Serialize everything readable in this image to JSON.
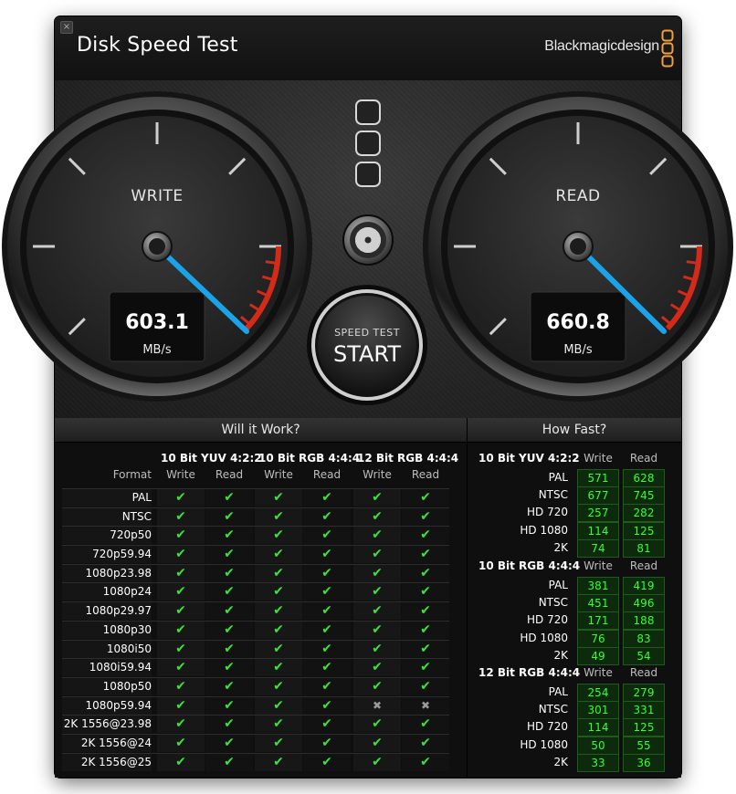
{
  "window": {
    "title": "Disk Speed Test",
    "brand": "Blackmagicdesign",
    "close_glyph": "×"
  },
  "gauges": {
    "write": {
      "label": "WRITE",
      "value": "603.1",
      "unit": "MB/s",
      "needle_fraction": 0.8
    },
    "read": {
      "label": "READ",
      "value": "660.8",
      "unit": "MB/s",
      "needle_fraction": 0.81
    }
  },
  "start_button": {
    "top_label": "SPEED TEST",
    "main_label": "START"
  },
  "colors": {
    "accent_blue": "#1aa3e8",
    "check_green": "#3ee03e",
    "speed_green": "#33ff33",
    "logo_orange": "#f0a040",
    "red_zone": "#d42a1a"
  },
  "will_it_work": {
    "title": "Will it Work?",
    "format_header": "Format",
    "groups": [
      "10 Bit YUV 4:2:2",
      "10 Bit RGB 4:4:4",
      "12 Bit RGB 4:4:4"
    ],
    "col_labels": [
      "Write",
      "Read"
    ],
    "check_glyph": "✔",
    "cross_glyph": "✖",
    "rows": [
      {
        "format": "PAL",
        "ok": [
          1,
          1,
          1,
          1,
          1,
          1
        ]
      },
      {
        "format": "NTSC",
        "ok": [
          1,
          1,
          1,
          1,
          1,
          1
        ]
      },
      {
        "format": "720p50",
        "ok": [
          1,
          1,
          1,
          1,
          1,
          1
        ]
      },
      {
        "format": "720p59.94",
        "ok": [
          1,
          1,
          1,
          1,
          1,
          1
        ]
      },
      {
        "format": "1080p23.98",
        "ok": [
          1,
          1,
          1,
          1,
          1,
          1
        ]
      },
      {
        "format": "1080p24",
        "ok": [
          1,
          1,
          1,
          1,
          1,
          1
        ]
      },
      {
        "format": "1080p29.97",
        "ok": [
          1,
          1,
          1,
          1,
          1,
          1
        ]
      },
      {
        "format": "1080p30",
        "ok": [
          1,
          1,
          1,
          1,
          1,
          1
        ]
      },
      {
        "format": "1080i50",
        "ok": [
          1,
          1,
          1,
          1,
          1,
          1
        ]
      },
      {
        "format": "1080i59.94",
        "ok": [
          1,
          1,
          1,
          1,
          1,
          1
        ]
      },
      {
        "format": "1080p50",
        "ok": [
          1,
          1,
          1,
          1,
          1,
          1
        ]
      },
      {
        "format": "1080p59.94",
        "ok": [
          1,
          1,
          1,
          1,
          0,
          0
        ]
      },
      {
        "format": "2K 1556@23.98",
        "ok": [
          1,
          1,
          1,
          1,
          1,
          1
        ]
      },
      {
        "format": "2K 1556@24",
        "ok": [
          1,
          1,
          1,
          1,
          1,
          1
        ]
      },
      {
        "format": "2K 1556@25",
        "ok": [
          1,
          1,
          1,
          1,
          1,
          1
        ]
      }
    ]
  },
  "how_fast": {
    "title": "How Fast?",
    "col_labels": [
      "Write",
      "Read"
    ],
    "groups": [
      {
        "name": "10 Bit YUV 4:2:2",
        "rows": [
          {
            "label": "PAL",
            "write": "571",
            "read": "628"
          },
          {
            "label": "NTSC",
            "write": "677",
            "read": "745"
          },
          {
            "label": "HD 720",
            "write": "257",
            "read": "282"
          },
          {
            "label": "HD 1080",
            "write": "114",
            "read": "125"
          },
          {
            "label": "2K",
            "write": "74",
            "read": "81"
          }
        ]
      },
      {
        "name": "10 Bit RGB 4:4:4",
        "rows": [
          {
            "label": "PAL",
            "write": "381",
            "read": "419"
          },
          {
            "label": "NTSC",
            "write": "451",
            "read": "496"
          },
          {
            "label": "HD 720",
            "write": "171",
            "read": "188"
          },
          {
            "label": "HD 1080",
            "write": "76",
            "read": "83"
          },
          {
            "label": "2K",
            "write": "49",
            "read": "54"
          }
        ]
      },
      {
        "name": "12 Bit RGB 4:4:4",
        "rows": [
          {
            "label": "PAL",
            "write": "254",
            "read": "279"
          },
          {
            "label": "NTSC",
            "write": "301",
            "read": "331"
          },
          {
            "label": "HD 720",
            "write": "114",
            "read": "125"
          },
          {
            "label": "HD 1080",
            "write": "50",
            "read": "55"
          },
          {
            "label": "2K",
            "write": "33",
            "read": "36"
          }
        ]
      }
    ]
  }
}
